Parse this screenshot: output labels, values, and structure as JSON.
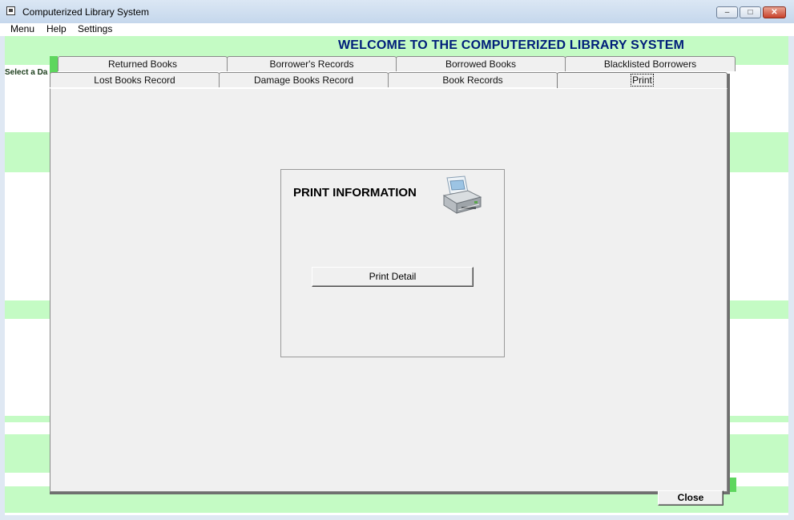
{
  "window": {
    "title": "Computerized Library System",
    "controls": {
      "minimize": "–",
      "maximize": "□",
      "close": "✕"
    }
  },
  "menubar": {
    "items": [
      "Menu",
      "Help",
      "Settings"
    ]
  },
  "banner": {
    "welcome": "WELCOME TO THE COMPUTERIZED LIBRARY SYSTEM"
  },
  "sidebar": {
    "select_label": "Select a Da"
  },
  "tabs": {
    "row_back": [
      "Returned Books",
      "Borrower's Records",
      "Borrowed Books",
      "Blacklisted Borrowers"
    ],
    "row_front": [
      "Lost Books Record",
      "Damage Books Record",
      "Book Records",
      "Print"
    ],
    "active": "Print"
  },
  "print_panel": {
    "heading": "PRINT INFORMATION",
    "print_button": "Print Detail",
    "icon": "printer-icon"
  },
  "footer": {
    "close_button": "Close"
  },
  "colors": {
    "stripe_green": "#c4fbc4",
    "welcome_blue": "#001e7a",
    "panel_gray": "#f0f0f0"
  }
}
